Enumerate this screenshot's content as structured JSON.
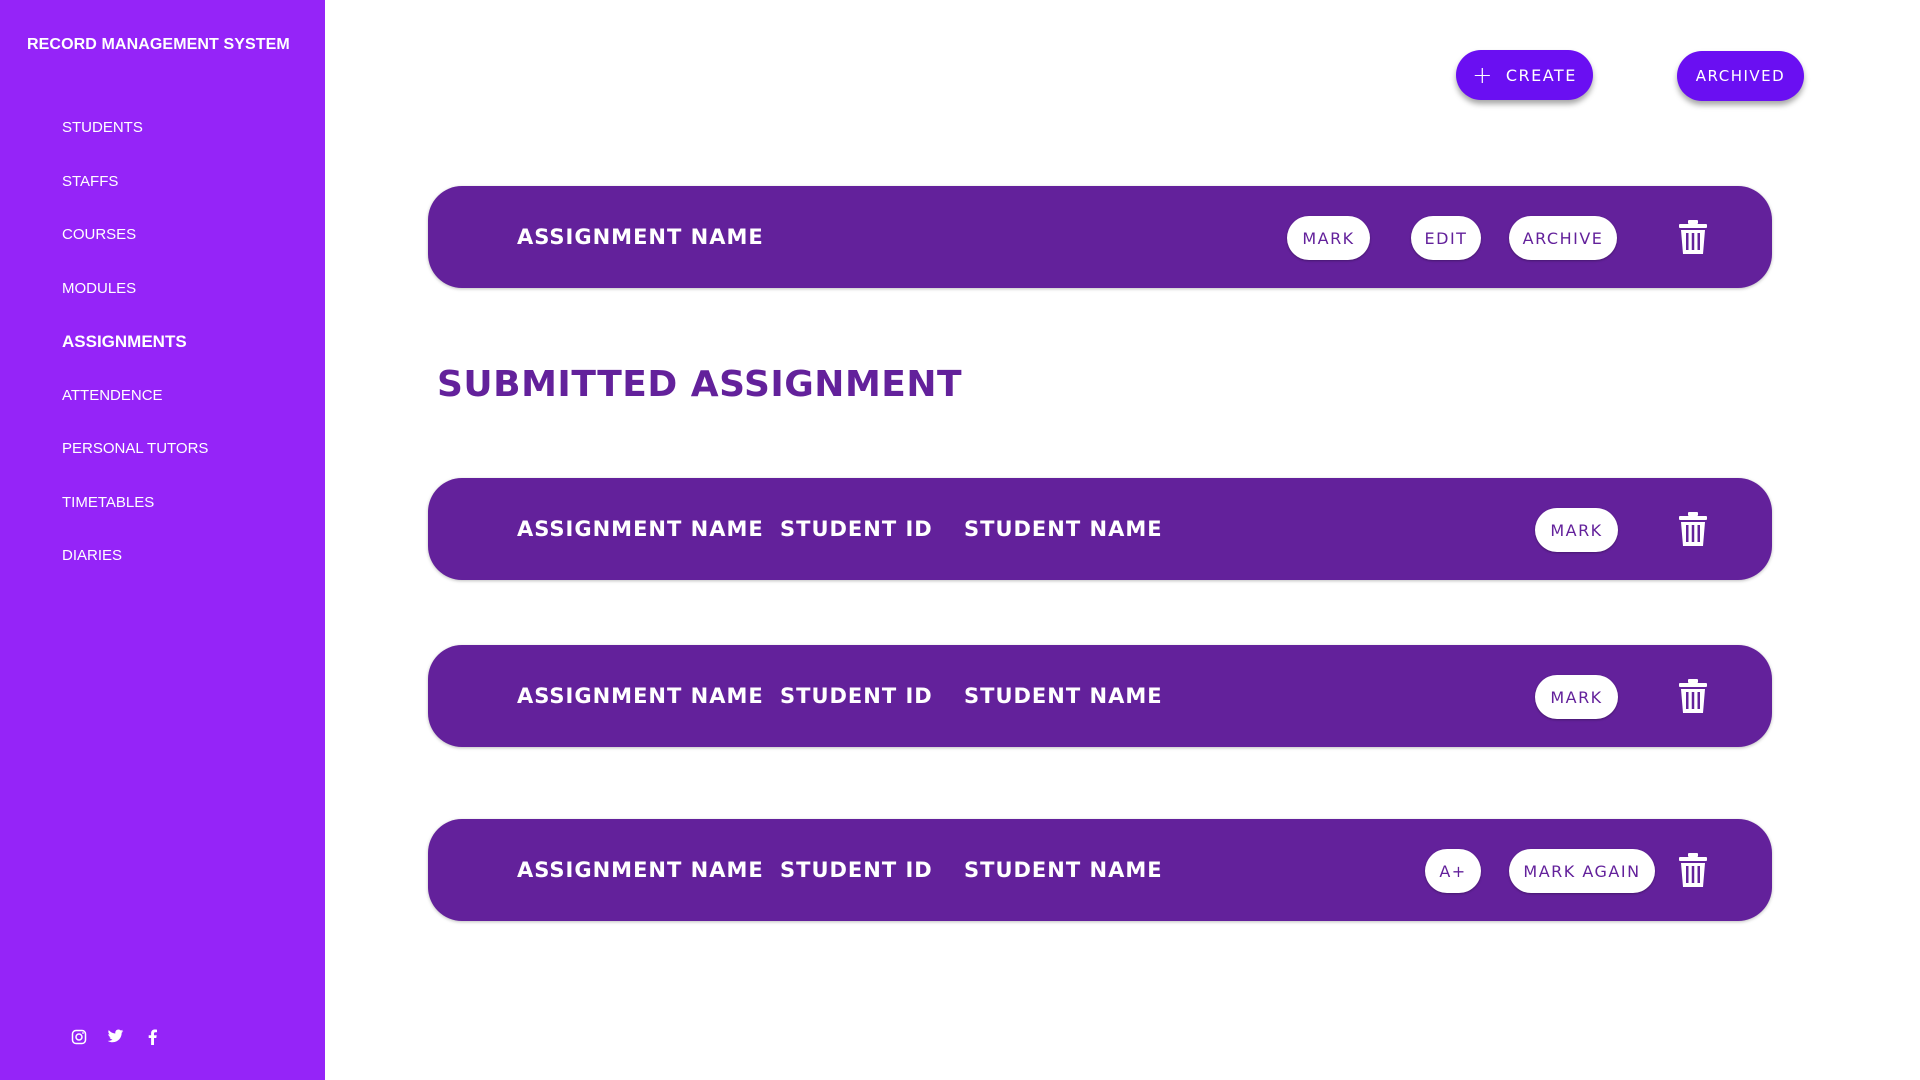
{
  "app": {
    "title": "RECORD MANAGEMENT SYSTEM"
  },
  "sidebar": {
    "items": [
      {
        "label": "STUDENTS"
      },
      {
        "label": "STAFFS"
      },
      {
        "label": "COURSES"
      },
      {
        "label": "MODULES"
      },
      {
        "label": "ASSIGNMENTS",
        "active": true
      },
      {
        "label": "ATTENDENCE"
      },
      {
        "label": "PERSONAL TUTORS"
      },
      {
        "label": "TIMETABLES"
      },
      {
        "label": "DIARIES"
      }
    ],
    "social": [
      "instagram-icon",
      "twitter-icon",
      "facebook-icon"
    ]
  },
  "header": {
    "create_label": "CREATE",
    "archived_label": "ARCHIVED"
  },
  "assignment": {
    "name": "ASSIGNMENT NAME",
    "mark_label": "MARK",
    "edit_label": "EDIT",
    "archive_label": "ARCHIVE"
  },
  "submitted": {
    "title": "SUBMITTED ASSIGNMENT",
    "rows": [
      {
        "assignment": "ASSIGNMENT NAME",
        "student_id": "STUDENT ID",
        "student_name": "STUDENT NAME",
        "action": "MARK"
      },
      {
        "assignment": "ASSIGNMENT NAME",
        "student_id": "STUDENT ID",
        "student_name": "STUDENT NAME",
        "action": "MARK"
      },
      {
        "assignment": "ASSIGNMENT NAME",
        "student_id": "STUDENT ID",
        "student_name": "STUDENT NAME",
        "grade": "A+",
        "action": "MARK AGAIN"
      }
    ]
  },
  "colors": {
    "sidebar": "#9524f8",
    "card": "#63219b",
    "button": "#6a0ff2"
  }
}
